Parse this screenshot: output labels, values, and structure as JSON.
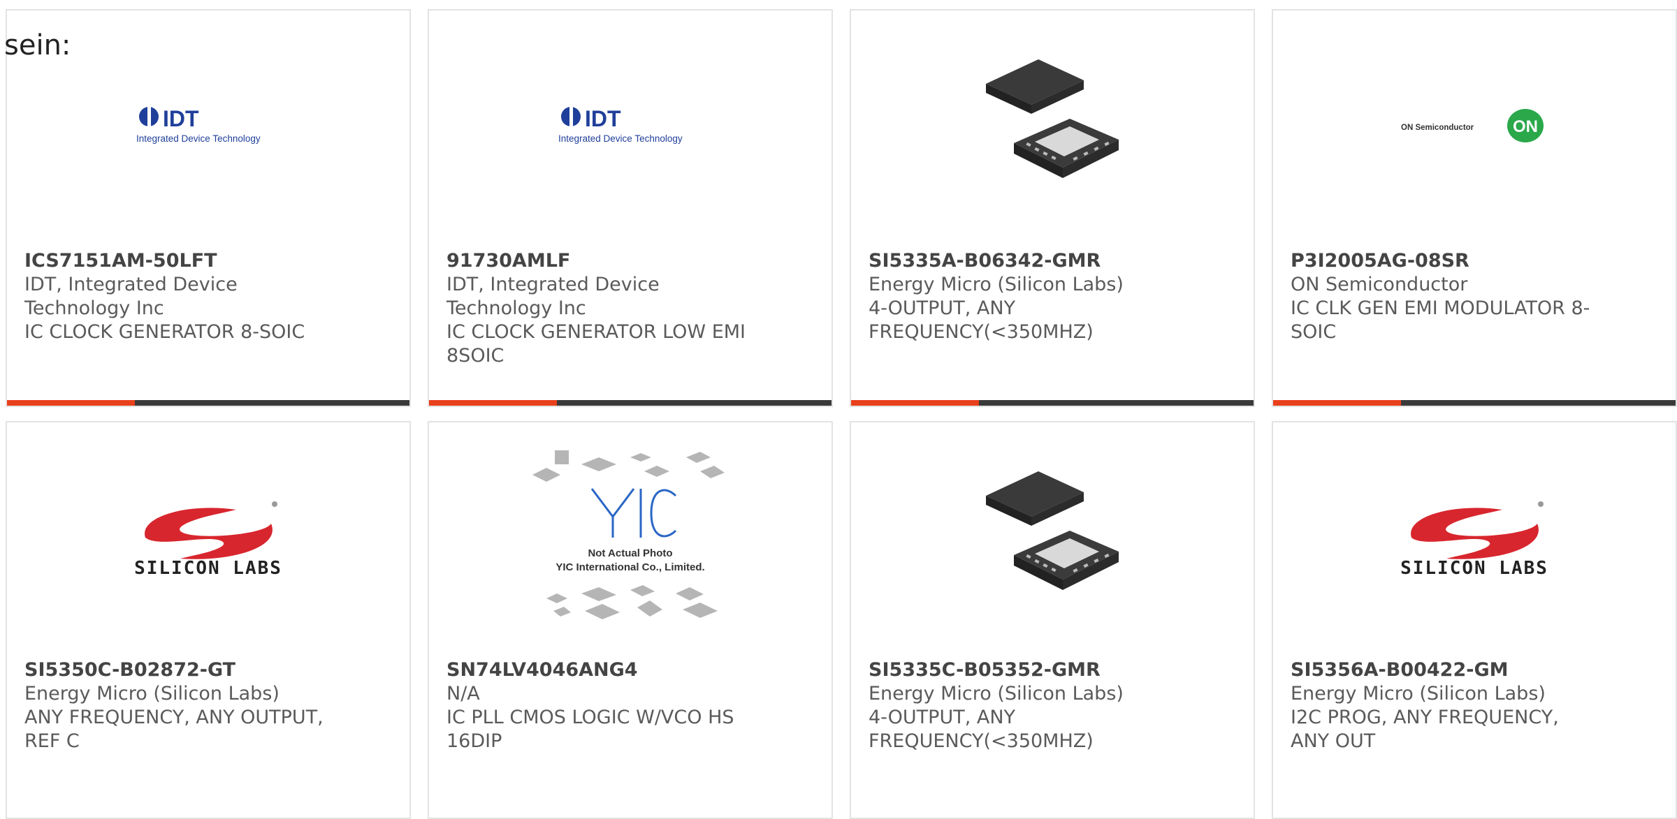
{
  "intro_text": "sein:",
  "colors": {
    "accent": "#e8401c",
    "bar": "#3a3a3a",
    "idt_blue": "#1f3f9a",
    "on_green": "#2aa84a",
    "silabs_red": "#d8262e"
  },
  "products": [
    {
      "part": "ICS7151AM-50LFT",
      "manufacturer": "IDT, Integrated Device Technology Inc",
      "description": "IC CLOCK GENERATOR 8-SOIC",
      "image": "idt-logo"
    },
    {
      "part": "91730AMLF",
      "manufacturer": "IDT, Integrated Device Technology Inc",
      "description": "IC CLOCK GENERATOR LOW EMI 8SOIC",
      "image": "idt-logo"
    },
    {
      "part": "SI5335A-B06342-GMR",
      "manufacturer": "Energy Micro (Silicon Labs)",
      "description": "4-OUTPUT, ANY FREQUENCY(<350MHZ)",
      "image": "qfn-chip"
    },
    {
      "part": "P3I2005AG-08SR",
      "manufacturer": "ON Semiconductor",
      "description": "IC CLK GEN EMI MODULATOR 8-SOIC",
      "image": "on-semi-logo"
    },
    {
      "part": "SI5350C-B02872-GT",
      "manufacturer": "Energy Micro (Silicon Labs)",
      "description": "ANY FREQUENCY, ANY OUTPUT, REF C",
      "image": "silicon-labs-logo"
    },
    {
      "part": "SN74LV4046ANG4",
      "manufacturer": "N/A",
      "description": "IC PLL CMOS LOGIC W/VCO HS 16DIP",
      "image": "yic-placeholder"
    },
    {
      "part": "SI5335C-B05352-GMR",
      "manufacturer": "Energy Micro (Silicon Labs)",
      "description": "4-OUTPUT, ANY FREQUENCY(<350MHZ)",
      "image": "qfn-chip"
    },
    {
      "part": "SI5356A-B00422-GM",
      "manufacturer": "Energy Micro (Silicon Labs)",
      "description": "I2C PROG, ANY FREQUENCY, ANY OUT",
      "image": "silicon-labs-logo"
    }
  ],
  "logos": {
    "idt_name": "IDT",
    "idt_tagline": "Integrated Device Technology",
    "on_name": "ON Semiconductor",
    "on_mark": "ON",
    "silicon_labs": "SILICON LABS",
    "yic_mark": "YIC",
    "yic_line1": "Not Actual Photo",
    "yic_line2": "YIC International Co., Limited."
  }
}
